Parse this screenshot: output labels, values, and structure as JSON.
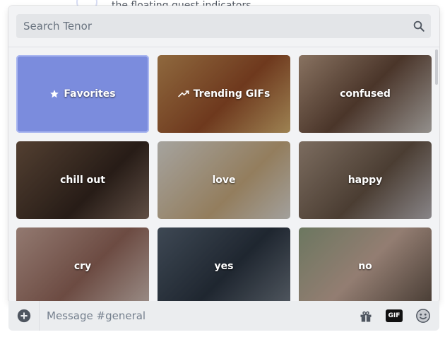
{
  "background": {
    "partial_text": "the floating quest indicators"
  },
  "search": {
    "placeholder": "Search Tenor"
  },
  "tiles": [
    {
      "label": "Favorites",
      "color": "#7b8cdd"
    },
    {
      "label": "Trending GIFs",
      "color": "#b9774a"
    },
    {
      "label": "confused",
      "color": "#8a6b55"
    },
    {
      "label": "chill out",
      "color": "#5a4438"
    },
    {
      "label": "love",
      "color": "#e8e2d6"
    },
    {
      "label": "happy",
      "color": "#8f7a6a"
    },
    {
      "label": "cry",
      "color": "#b9918a"
    },
    {
      "label": "yes",
      "color": "#3f4b5a"
    },
    {
      "label": "no",
      "color": "#a49180"
    }
  ],
  "message": {
    "placeholder": "Message #general"
  },
  "toolbar": {
    "gif_label": "GIF"
  }
}
